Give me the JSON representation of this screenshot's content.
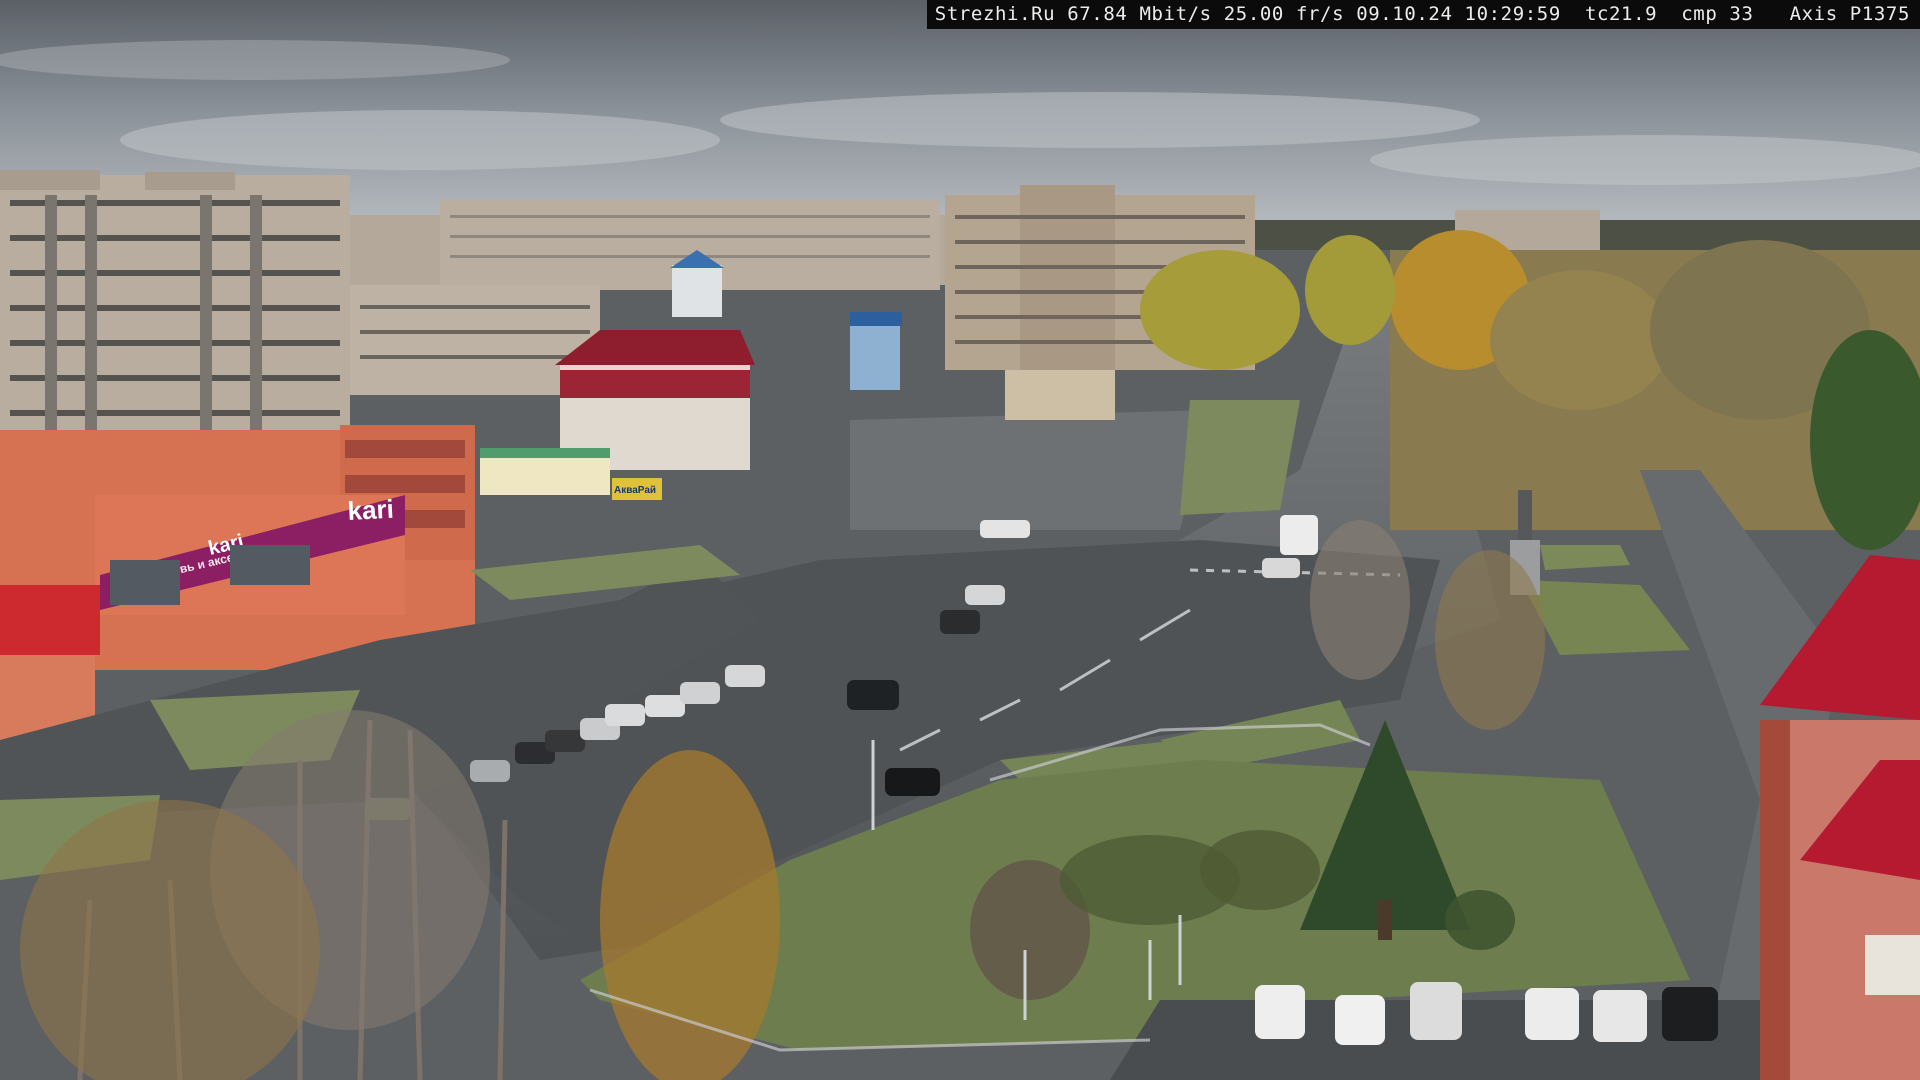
{
  "overlay": {
    "site": "Strezhi.Ru",
    "bandwidth": "67.84 Mbit/s",
    "framerate": "25.00 fr/s",
    "date": "09.10.24",
    "time": "10:29:59",
    "tc": "tc21.9",
    "cmp": "cmp 33",
    "camera": "Axis P1375"
  },
  "signs": {
    "store_brand": "kari",
    "store_tagline": "обувь и аксессуары",
    "store_brand_2": "kari",
    "shop_sign": "АкваРай"
  },
  "colors": {
    "sky": "#8e959c",
    "asphalt": "#5b5e60",
    "grass": "#7b8a5a",
    "store_magenta": "#8c1f63",
    "roof_red": "#b51a30"
  }
}
